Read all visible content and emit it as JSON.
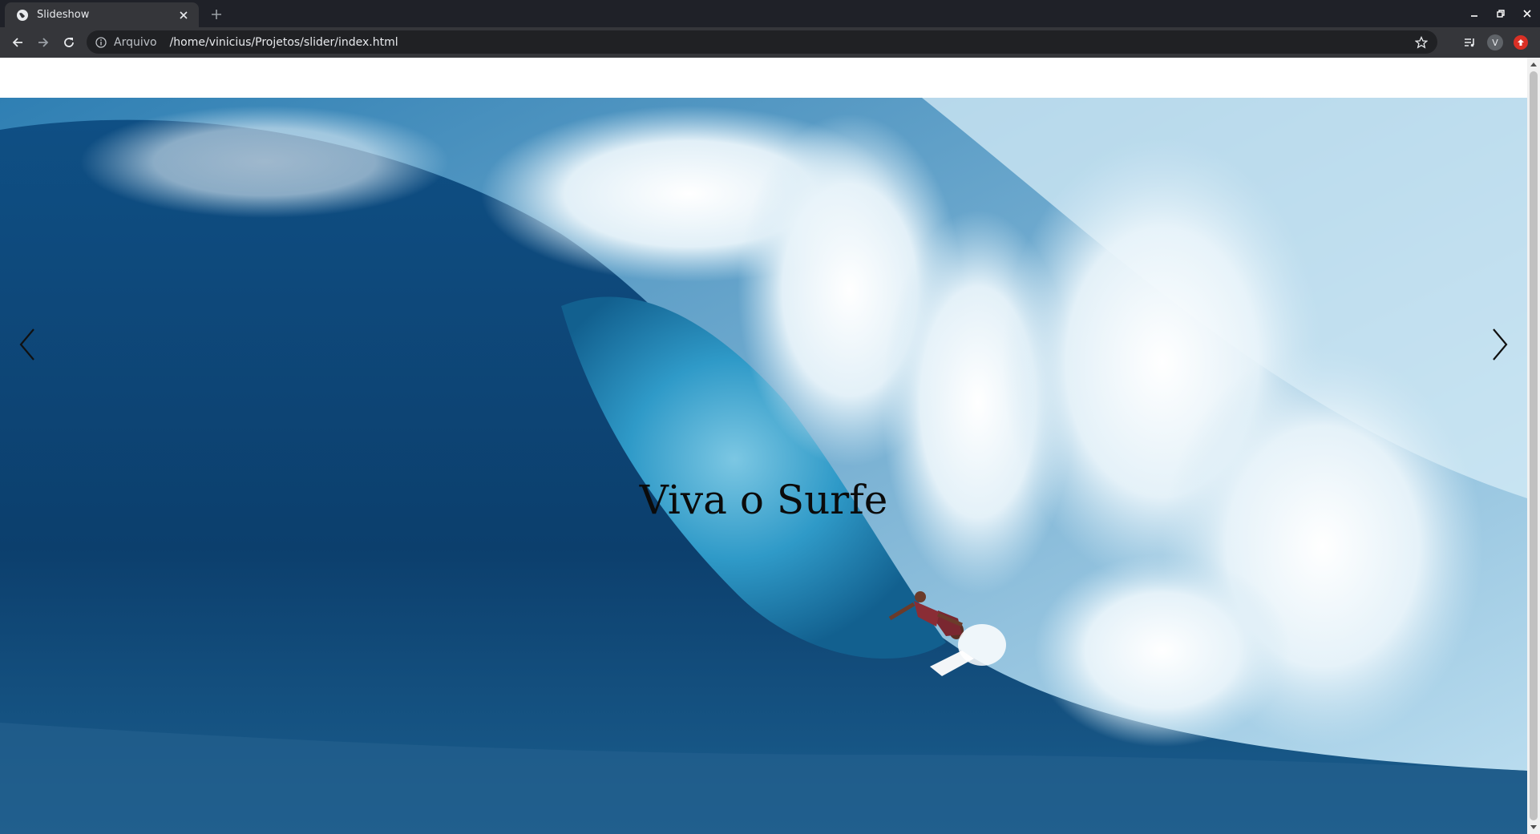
{
  "browser": {
    "tab_title": "Slideshow",
    "new_tab_symbol": "+",
    "address_scheme": "Arquivo",
    "address_url": "/home/vinicius/Projetos/slider/index.html",
    "profile_initial": "V",
    "icons": {
      "back": "arrow-left-icon",
      "forward": "arrow-right-icon",
      "reload": "reload-icon",
      "info": "info-icon",
      "bookmark": "star-icon",
      "media": "media-control-icon",
      "update": "update-available-icon"
    },
    "colors": {
      "titlebar": "#1f2128",
      "toolbar": "#35363a",
      "omnibox": "#202124",
      "update_badge": "#d93025"
    }
  },
  "slider": {
    "caption": "Viva o Surfe",
    "prev_symbol": "‹",
    "next_symbol": "›",
    "image": "surfer-riding-big-wave"
  }
}
